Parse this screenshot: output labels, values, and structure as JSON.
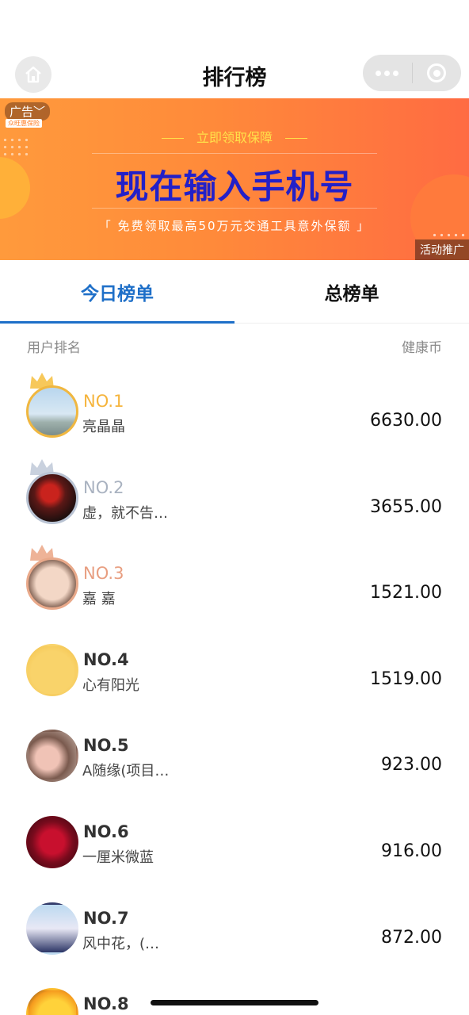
{
  "nav": {
    "title": "排行榜",
    "home_icon": "home-icon",
    "more_icon": "more-dots-icon",
    "close_icon": "target-close-icon"
  },
  "ad": {
    "tag": "广告",
    "logo": "众旺惠保险",
    "top_text": "立即领取保障",
    "main_text": "现在输入手机号",
    "sub_text": "「 免费领取最高50万元交通工具意外保额 」",
    "promo": "活动推广",
    "colors": {
      "bg_start": "#ff9a3c",
      "bg_end": "#ff6b42",
      "headline": "#2320c8",
      "accent": "#ffe14a"
    }
  },
  "tabs": [
    {
      "label": "今日榜单",
      "active": true
    },
    {
      "label": "总榜单",
      "active": false
    }
  ],
  "list_header": {
    "left": "用户排名",
    "right": "健康币"
  },
  "accent_color": "#1e6fc8",
  "rankings": [
    {
      "rank": "NO.1",
      "name": "亮晶晶",
      "coins": "6630.00"
    },
    {
      "rank": "NO.2",
      "name": "虚，就不告…",
      "coins": "3655.00"
    },
    {
      "rank": "NO.3",
      "name": "嘉 嘉",
      "coins": "1521.00"
    },
    {
      "rank": "NO.4",
      "name": "心有阳光",
      "coins": "1519.00"
    },
    {
      "rank": "NO.5",
      "name": "A随缘(项目…",
      "coins": "923.00"
    },
    {
      "rank": "NO.6",
      "name": "一厘米微蓝",
      "coins": "916.00"
    },
    {
      "rank": "NO.7",
      "name": "风中花，(…",
      "coins": "872.00"
    },
    {
      "rank": "NO.8",
      "name": "",
      "coins": ""
    }
  ]
}
